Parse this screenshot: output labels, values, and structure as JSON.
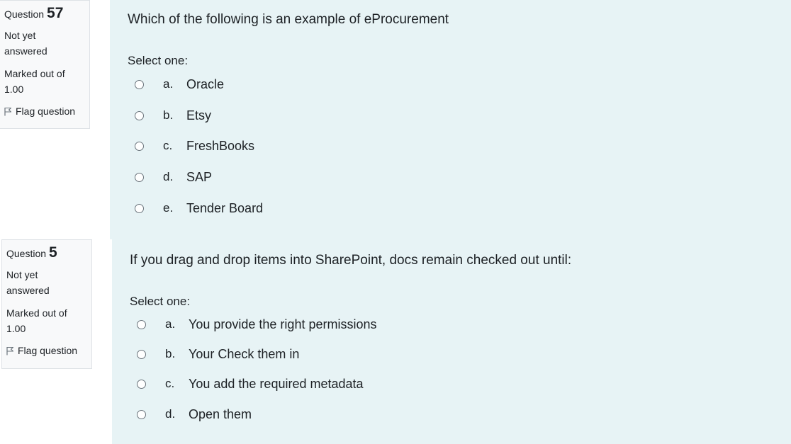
{
  "questions": [
    {
      "label": "Question",
      "number": "57",
      "state_line1": "Not yet",
      "state_line2": "answered",
      "grade_line1": "Marked out of",
      "grade_line2": "1.00",
      "flag_label": "Flag question",
      "text": "Which of the following is an example of eProcurement",
      "prompt": "Select one:",
      "answers": [
        {
          "letter": "a.",
          "text": "Oracle"
        },
        {
          "letter": "b.",
          "text": "Etsy"
        },
        {
          "letter": "c.",
          "text": "FreshBooks"
        },
        {
          "letter": "d.",
          "text": "SAP"
        },
        {
          "letter": "e.",
          "text": "Tender Board"
        }
      ]
    },
    {
      "label": "Question",
      "number": "5",
      "state_line1": "Not yet",
      "state_line2": "answered",
      "grade_line1": "Marked out of",
      "grade_line2": "1.00",
      "flag_label": "Flag question",
      "text": "If you drag and drop items into SharePoint, docs remain checked out until:",
      "prompt": "Select one:",
      "answers": [
        {
          "letter": "a.",
          "text": "You provide the right permissions"
        },
        {
          "letter": "b.",
          "text": "Your Check them in"
        },
        {
          "letter": "c.",
          "text": "You add the required metadata"
        },
        {
          "letter": "d.",
          "text": "Open them"
        }
      ]
    }
  ]
}
